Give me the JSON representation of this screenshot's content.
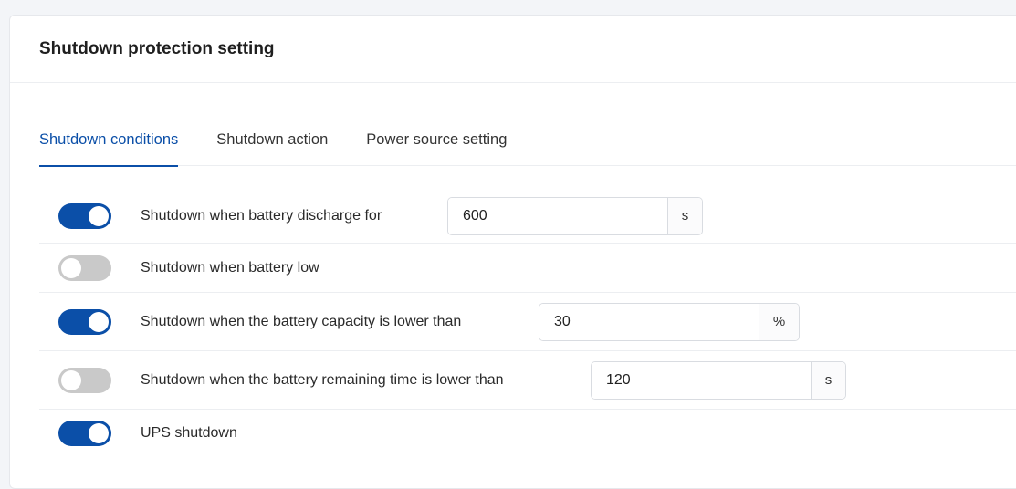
{
  "card": {
    "title": "Shutdown protection setting"
  },
  "tabs": [
    {
      "label": "Shutdown conditions",
      "active": true
    },
    {
      "label": "Shutdown action",
      "active": false
    },
    {
      "label": "Power source setting",
      "active": false
    }
  ],
  "conditions": [
    {
      "label": "Shutdown when battery discharge for",
      "enabled": true,
      "value": "600",
      "unit": "s"
    },
    {
      "label": "Shutdown when battery low",
      "enabled": false
    },
    {
      "label": "Shutdown when the battery capacity is lower than",
      "enabled": true,
      "value": "30",
      "unit": "%"
    },
    {
      "label": "Shutdown when the battery remaining time is lower than",
      "enabled": false,
      "value": "120",
      "unit": "s"
    },
    {
      "label": "UPS shutdown",
      "enabled": true
    }
  ],
  "colors": {
    "accent": "#0b4fa8",
    "toggle_off": "#c9c9c9",
    "border": "#d9dce1"
  },
  "icons": {
    "toggle": "toggle-switch"
  }
}
